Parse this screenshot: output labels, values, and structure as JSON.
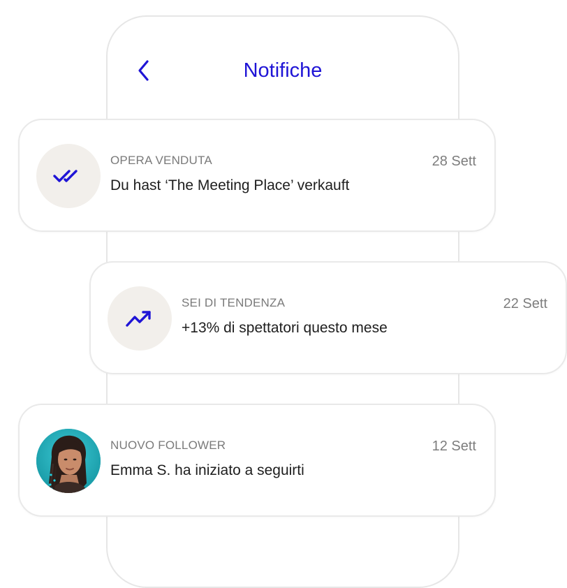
{
  "header": {
    "back_icon": "chevron-left-icon",
    "title": "Notifiche"
  },
  "colors": {
    "accent": "#1f14d6",
    "icon_bg": "#f2efeb",
    "label": "#7a7a7a",
    "text": "#1e1e1e",
    "avatar_bg": "#1fb3c0"
  },
  "notifications": [
    {
      "icon": "double-check-icon",
      "label": "OPERA VENDUTA",
      "date": "28 Sett",
      "message": "Du hast ‘The Meeting Place’ verkauft"
    },
    {
      "icon": "trending-up-icon",
      "label": "SEI DI TENDENZA",
      "date": "22 Sett",
      "message": "+13% di spettatori questo mese"
    },
    {
      "icon": "avatar",
      "label": "NUOVO FOLLOWER",
      "date": "12 Sett",
      "message": "Emma S. ha iniziato a seguirti"
    }
  ]
}
